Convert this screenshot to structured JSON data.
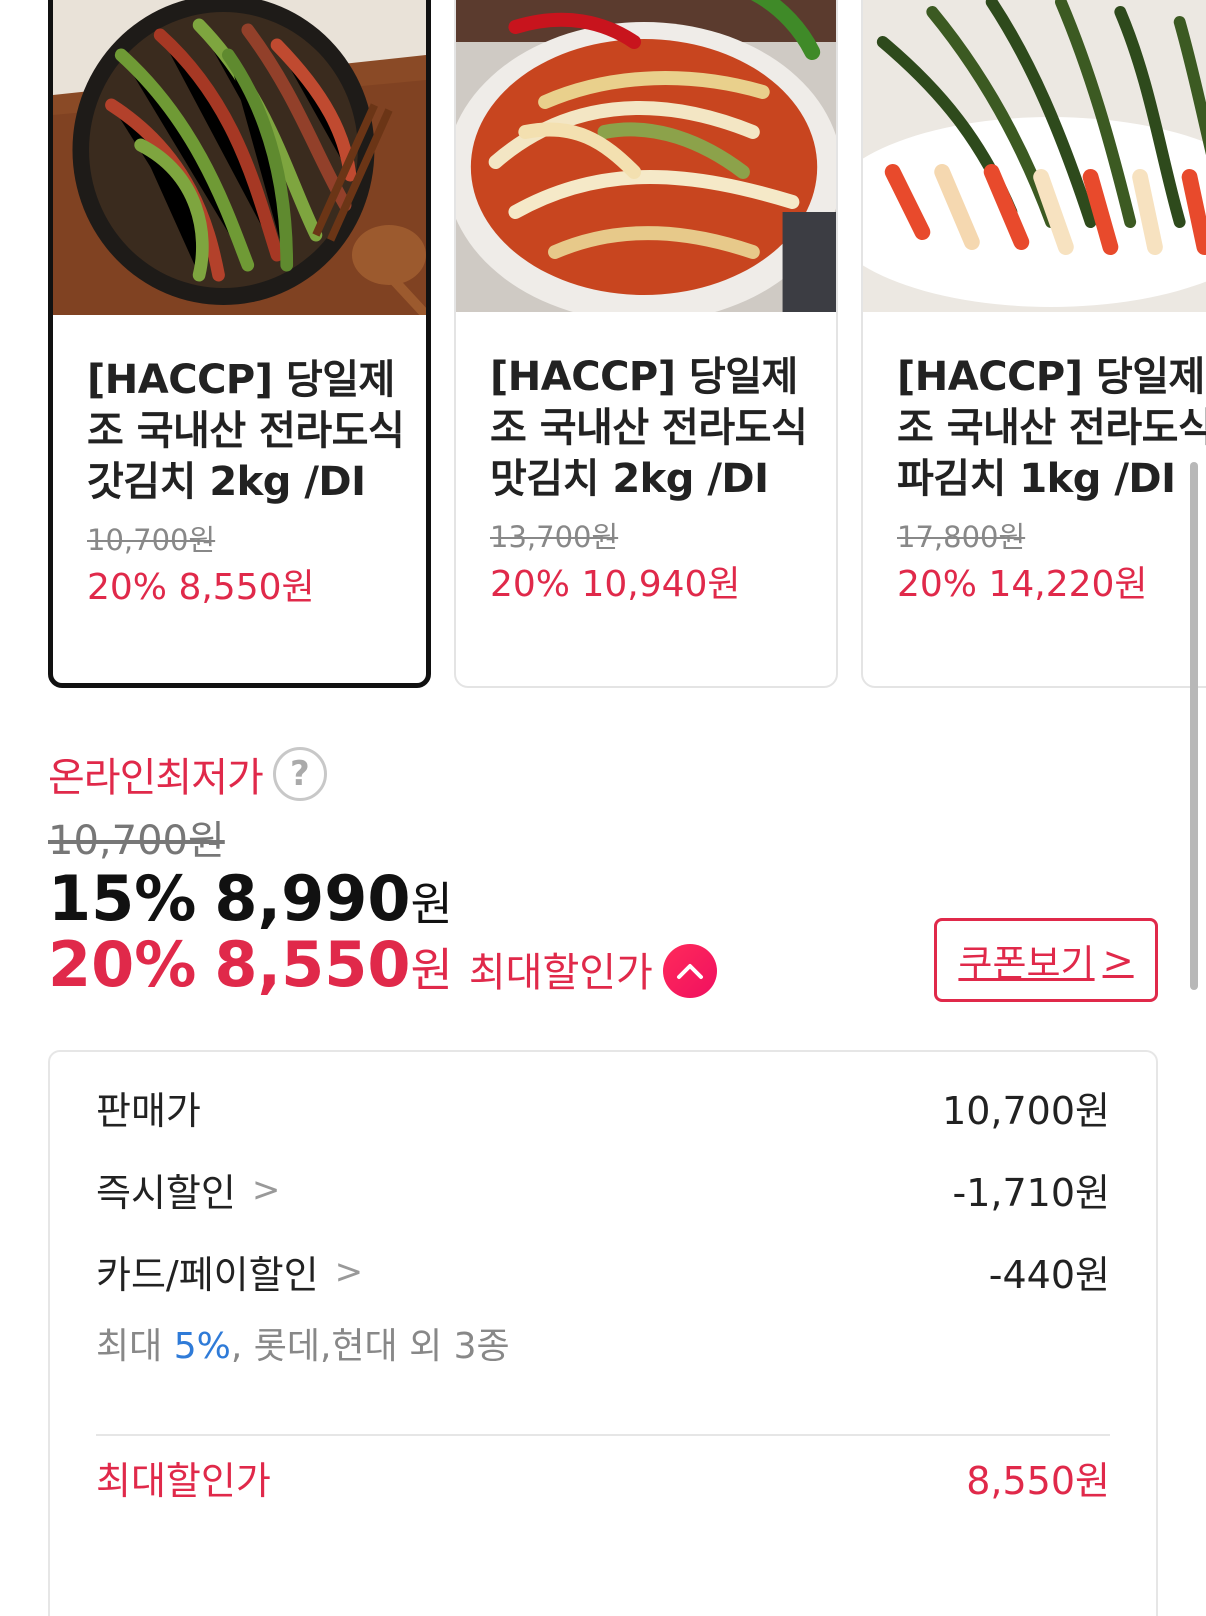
{
  "products": [
    {
      "title": "[HACCP] 당일제\n조 국내산 전라도식\n갓김치 2kg /DI",
      "original_price": "10,700원",
      "sale": "20% 8,550원",
      "selected": true,
      "image": "mustard-greens-kimchi"
    },
    {
      "title": "[HACCP] 당일제\n조 국내산 전라도식\n맛김치 2kg /DI",
      "original_price": "13,700원",
      "sale": "20% 10,940원",
      "selected": false,
      "image": "cabbage-kimchi"
    },
    {
      "title": "[HACCP] 당일제\n조 국내산 전라도식\n파김치 1kg /DI",
      "original_price": "17,800원",
      "sale": "20% 14,220원",
      "selected": false,
      "image": "green-onion-kimchi"
    }
  ],
  "price": {
    "lowest_label": "온라인최저가",
    "help_icon": "?",
    "original": "10,700원",
    "discount15_pct": "15%",
    "discount15_amount": "8,990",
    "won": "원",
    "discount20_pct": "20%",
    "discount20_amount": "8,550",
    "max_label": "최대할인가",
    "coupon_button": "쿠폰보기",
    "coupon_chevron": ">"
  },
  "breakdown": {
    "sale_price_label": "판매가",
    "sale_price": "10,700원",
    "instant_label": "즉시할인",
    "instant_value": "-1,710원",
    "card_label": "카드/페이할인",
    "card_value": "-440원",
    "card_note_prefix": "최대 ",
    "card_note_highlight": "5%",
    "card_note_suffix": ", 롯데,현대 외 3종",
    "chevron": ">",
    "total_label": "최대할인가",
    "total_value": "8,550원"
  },
  "colors": {
    "accent": "#e0294a",
    "blue": "#2f7bd8",
    "text": "#111111",
    "muted": "#888888"
  }
}
